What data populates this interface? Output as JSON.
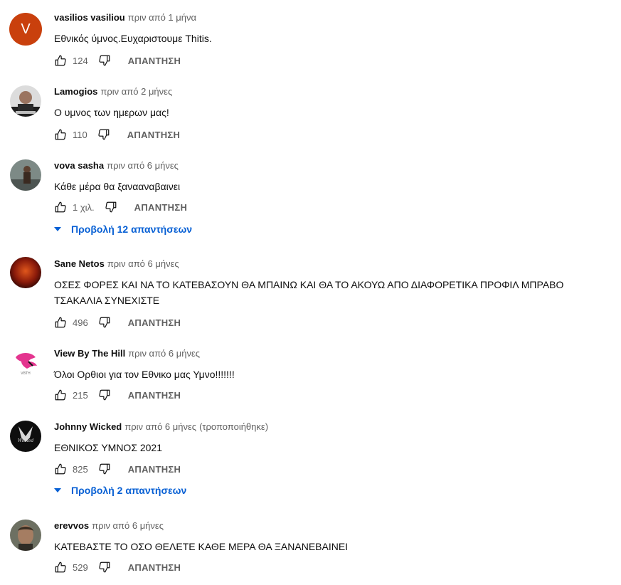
{
  "ui": {
    "reply_label": "ΑΠΑΝΤΗΣΗ"
  },
  "comments": [
    {
      "author": "vasilios vasiliou",
      "time": "πριν από 1 μήνα",
      "text": "Εθνικός ύμνος.Ευχαριστουμε Thitis.",
      "likes": "124",
      "avatar_letter": "V"
    },
    {
      "author": "Lamogios",
      "time": "πριν από 2 μήνες",
      "text": "Ο υμνος των ημερων μας!",
      "likes": "110"
    },
    {
      "author": "vova sasha",
      "time": "πριν από 6 μήνες",
      "text": "Κάθε μέρα θα ξανααναβαινει",
      "likes": "1 χιλ.",
      "replies": "Προβολή 12 απαντήσεων"
    },
    {
      "author": "Sane Netos",
      "time": "πριν από 6 μήνες",
      "text": "ΟΣΕΣ ΦΟΡΕΣ ΚΑΙ ΝΑ ΤΟ ΚΑΤΕΒΑΣΟΥΝ ΘΑ ΜΠΑΙΝΩ ΚΑΙ ΘΑ ΤΟ ΑΚΟΥΩ ΑΠΟ ΔΙΑΦΟΡΕΤΙΚΑ ΠΡΟΦΙΛ ΜΠΡΑΒΟ ΤΣΑΚΑΛΙΑ ΣΥΝΕΧΙΣΤΕ",
      "likes": "496"
    },
    {
      "author": "View By The Hill",
      "time": "πριν από 6 μήνες",
      "text": "Όλοι Ορθιοι για τον Εθνικο μας Υμνο!!!!!!!",
      "likes": "215"
    },
    {
      "author": "Johnny Wicked",
      "time": "πριν από 6 μήνες",
      "edited": "(τροποποιήθηκε)",
      "text": "ΕΘΝΙΚΟΣ ΥΜΝΟΣ 2021",
      "likes": "825",
      "replies": "Προβολή 2 απαντήσεων"
    },
    {
      "author": "erevvos",
      "time": "πριν από 6 μήνες",
      "text": "ΚΑΤΕΒΑΣΤΕ ΤΟ ΟΣΟ ΘΕΛΕΤΕ ΚΑΘΕ ΜΕΡΑ ΘΑ ΞΑΝΑΝΕΒΑΙΝΕΙ",
      "likes": "529"
    }
  ]
}
